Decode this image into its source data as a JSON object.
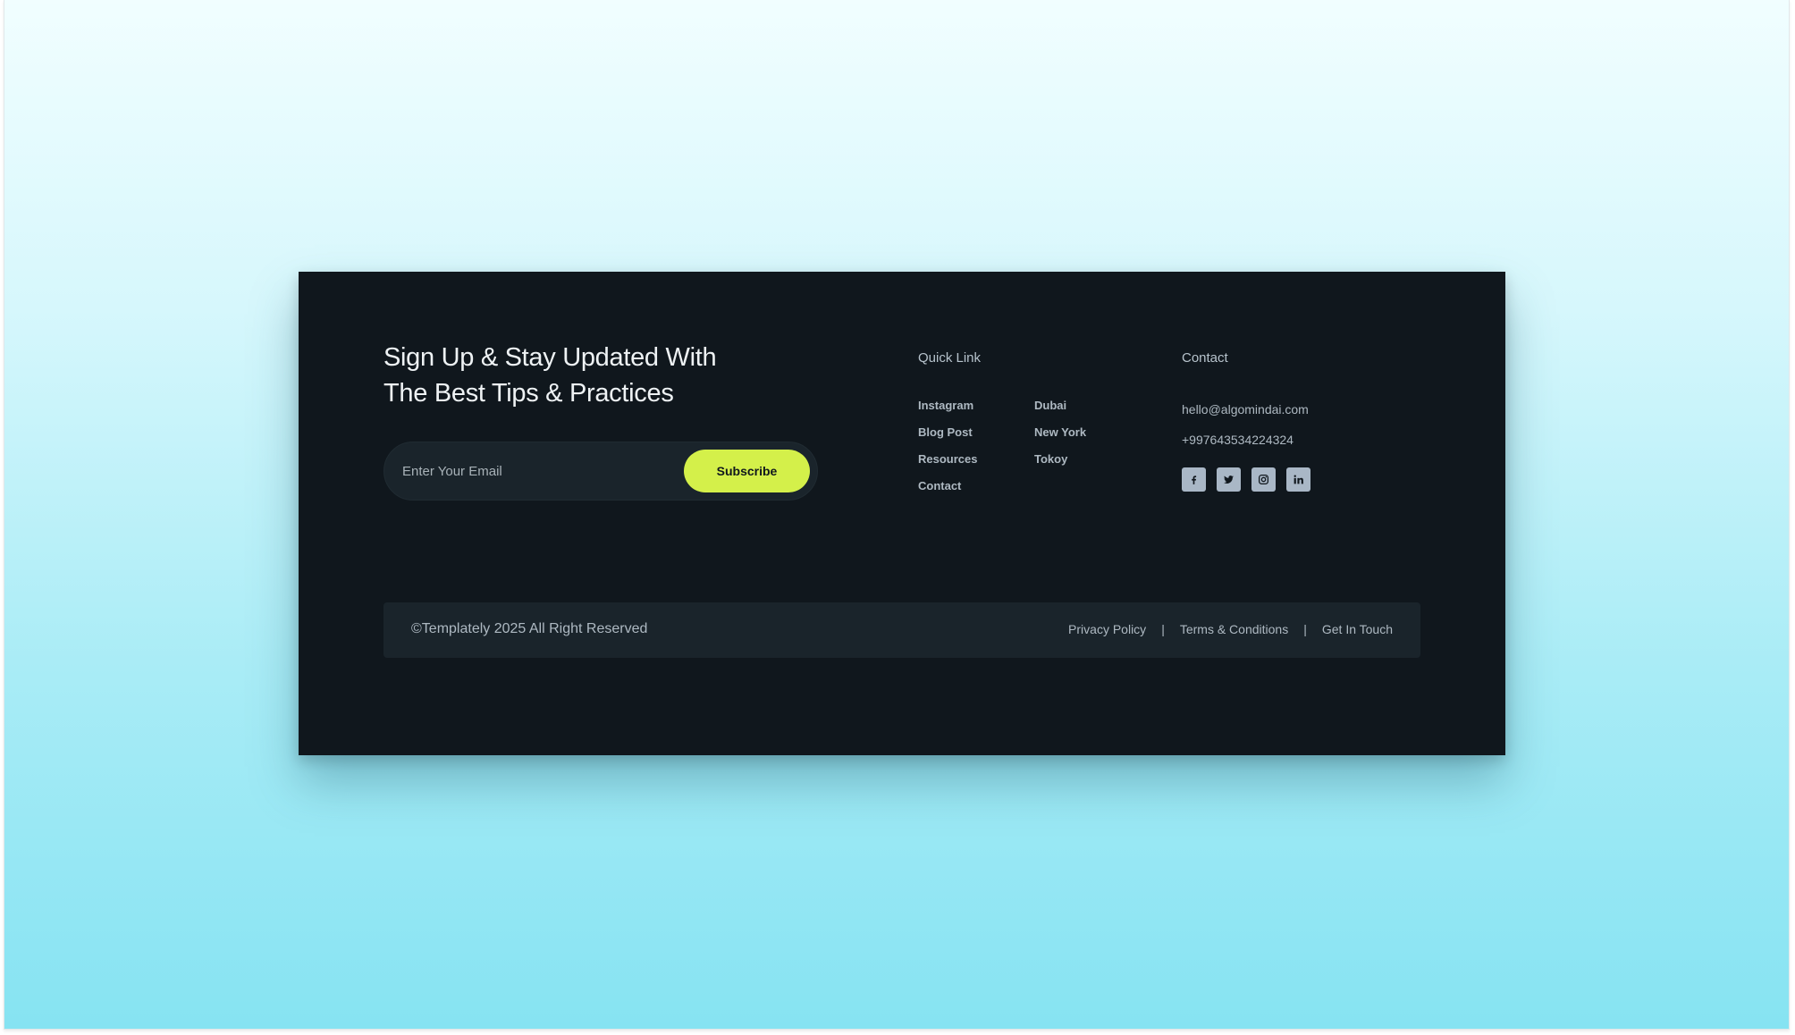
{
  "newsletter": {
    "headline_line1": "Sign Up & Stay Updated With",
    "headline_line2": "The Best Tips & Practices",
    "email_placeholder": "Enter Your Email",
    "subscribe_label": "Subscribe"
  },
  "quick_links": {
    "title": "Quick Link",
    "column1": [
      "Instagram",
      "Blog Post",
      "Resources",
      "Contact"
    ],
    "column2": [
      "Dubai",
      "New York",
      "Tokoy"
    ]
  },
  "contact": {
    "title": "Contact",
    "email": "hello@algomindai.com",
    "phone": "+997643534224324",
    "social": [
      {
        "name": "facebook-icon"
      },
      {
        "name": "twitter-icon"
      },
      {
        "name": "instagram-icon"
      },
      {
        "name": "linkedin-icon"
      }
    ]
  },
  "bottom_bar": {
    "copyright": "©Templately 2025 All Right Reserved",
    "links": [
      "Privacy Policy",
      "Terms & Conditions",
      "Get In Touch"
    ],
    "separator": "|"
  },
  "colors": {
    "card_bg": "#10171d",
    "accent": "#d4f04a",
    "panel_bg": "#1a242b",
    "muted_text": "#aeb9c2",
    "icon_bg": "#a9b7c6"
  }
}
